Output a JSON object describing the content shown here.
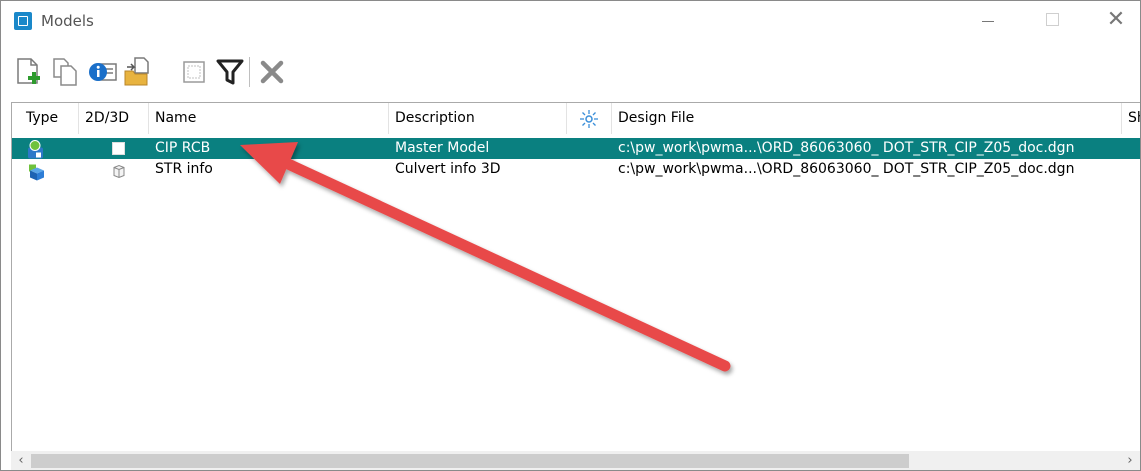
{
  "window": {
    "title": "Models"
  },
  "toolbar": {
    "buttons": [
      {
        "name": "create-model",
        "icon": "page-plus-icon"
      },
      {
        "name": "copy-model",
        "icon": "copy-pages-icon"
      },
      {
        "name": "model-properties",
        "icon": "info-icon"
      },
      {
        "name": "import-model",
        "icon": "folder-import-icon"
      },
      {
        "name": "model-settings",
        "icon": "frame-icon"
      },
      {
        "name": "filter",
        "icon": "filter-icon"
      },
      {
        "name": "delete-model",
        "icon": "delete-x-icon"
      }
    ]
  },
  "columns": {
    "type": "Type",
    "dim": "2D/3D",
    "name": "Name",
    "description": "Description",
    "design_file": "Design File",
    "next": "Sh"
  },
  "rows": [
    {
      "name": "CIP RCB",
      "description": "Master Model",
      "design_file": "c:\\pw_work\\pwma...\\ORD_86063060_ DOT_STR_CIP_Z05_doc.dgn",
      "selected": true,
      "dim": "2D"
    },
    {
      "name": "STR info",
      "description": "Culvert info 3D",
      "design_file": "c:\\pw_work\\pwma...\\ORD_86063060_ DOT_STR_CIP_Z05_doc.dgn",
      "selected": false,
      "dim": "3D"
    }
  ],
  "scrollbar": {
    "left_arrow": "‹",
    "right_arrow": "›"
  },
  "colors": {
    "selection": "#0a8080",
    "annotation_arrow": "#e84a4a",
    "accent": "#1a88c9"
  }
}
